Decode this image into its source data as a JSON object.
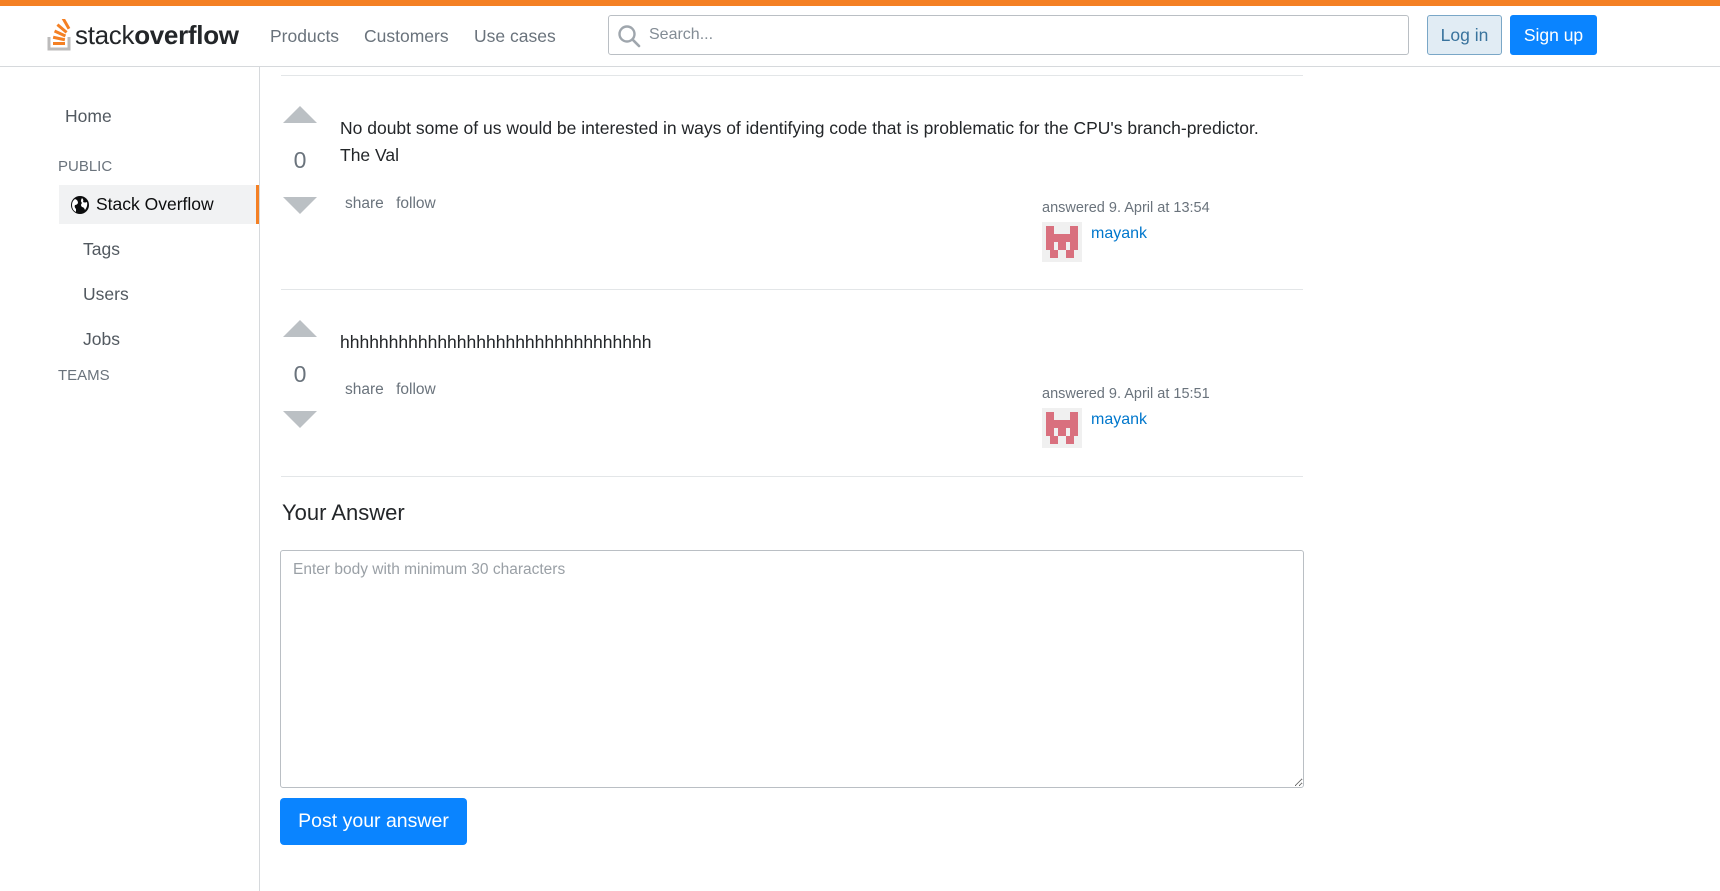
{
  "header": {
    "logo_light": "stack",
    "logo_bold": "overflow",
    "nav": [
      "Products",
      "Customers",
      "Use cases"
    ],
    "search_placeholder": "Search...",
    "login_label": "Log in",
    "signup_label": "Sign up"
  },
  "sidebar": {
    "home_label": "Home",
    "public_label": "PUBLIC",
    "active_label": "Stack Overflow",
    "items": [
      "Tags",
      "Users",
      "Jobs"
    ],
    "teams_label": "TEAMS"
  },
  "answers": [
    {
      "votes": "0",
      "body": "No doubt some of us would be interested in ways of identifying code that is problematic for the CPU's branch-predictor. The Val",
      "share_label": "share",
      "follow_label": "follow",
      "action": "answered 9. April at 13:54",
      "user": "mayank"
    },
    {
      "votes": "0",
      "body": "hhhhhhhhhhhhhhhhhhhhhhhhhhhhhhhh",
      "share_label": "share",
      "follow_label": "follow",
      "action": "answered 9. April at 15:51",
      "user": "mayank"
    }
  ],
  "your_answer": {
    "title": "Your Answer",
    "placeholder": "Enter body with minimum 30 characters",
    "post_label": "Post your answer"
  },
  "colors": {
    "accent": "#f48024",
    "primary": "#0a84ff",
    "link": "#0077cc",
    "avatar": "#d9707e"
  },
  "icons": {
    "logo": "stack-overflow-logo-icon",
    "search": "search-icon",
    "globe": "globe-icon",
    "upvote": "upvote-arrow-icon",
    "downvote": "downvote-arrow-icon"
  }
}
